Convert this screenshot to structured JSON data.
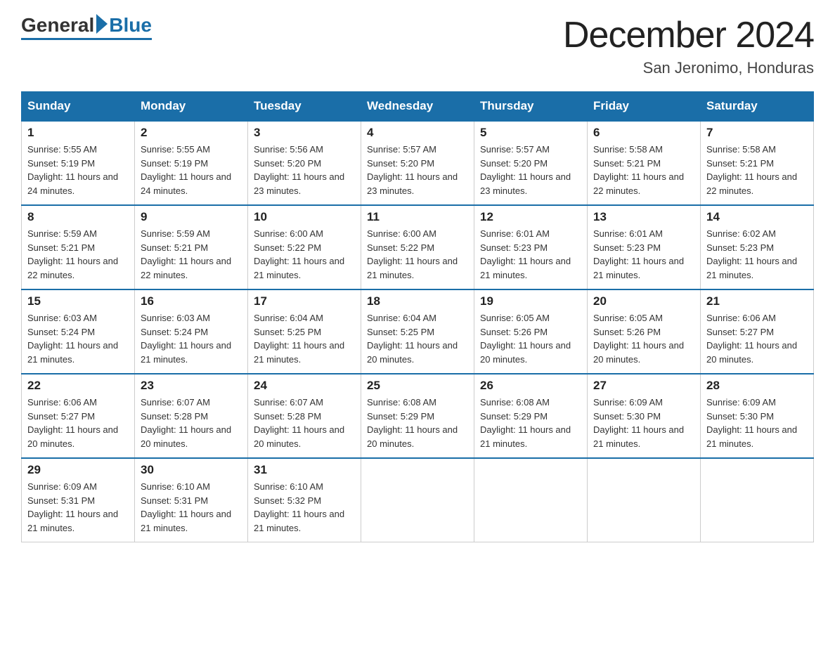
{
  "header": {
    "logo_general": "General",
    "logo_blue": "Blue",
    "month_title": "December 2024",
    "location": "San Jeronimo, Honduras"
  },
  "weekdays": [
    "Sunday",
    "Monday",
    "Tuesday",
    "Wednesday",
    "Thursday",
    "Friday",
    "Saturday"
  ],
  "weeks": [
    [
      {
        "day": "1",
        "sunrise": "5:55 AM",
        "sunset": "5:19 PM",
        "daylight": "11 hours and 24 minutes."
      },
      {
        "day": "2",
        "sunrise": "5:55 AM",
        "sunset": "5:19 PM",
        "daylight": "11 hours and 24 minutes."
      },
      {
        "day": "3",
        "sunrise": "5:56 AM",
        "sunset": "5:20 PM",
        "daylight": "11 hours and 23 minutes."
      },
      {
        "day": "4",
        "sunrise": "5:57 AM",
        "sunset": "5:20 PM",
        "daylight": "11 hours and 23 minutes."
      },
      {
        "day": "5",
        "sunrise": "5:57 AM",
        "sunset": "5:20 PM",
        "daylight": "11 hours and 23 minutes."
      },
      {
        "day": "6",
        "sunrise": "5:58 AM",
        "sunset": "5:21 PM",
        "daylight": "11 hours and 22 minutes."
      },
      {
        "day": "7",
        "sunrise": "5:58 AM",
        "sunset": "5:21 PM",
        "daylight": "11 hours and 22 minutes."
      }
    ],
    [
      {
        "day": "8",
        "sunrise": "5:59 AM",
        "sunset": "5:21 PM",
        "daylight": "11 hours and 22 minutes."
      },
      {
        "day": "9",
        "sunrise": "5:59 AM",
        "sunset": "5:21 PM",
        "daylight": "11 hours and 22 minutes."
      },
      {
        "day": "10",
        "sunrise": "6:00 AM",
        "sunset": "5:22 PM",
        "daylight": "11 hours and 21 minutes."
      },
      {
        "day": "11",
        "sunrise": "6:00 AM",
        "sunset": "5:22 PM",
        "daylight": "11 hours and 21 minutes."
      },
      {
        "day": "12",
        "sunrise": "6:01 AM",
        "sunset": "5:23 PM",
        "daylight": "11 hours and 21 minutes."
      },
      {
        "day": "13",
        "sunrise": "6:01 AM",
        "sunset": "5:23 PM",
        "daylight": "11 hours and 21 minutes."
      },
      {
        "day": "14",
        "sunrise": "6:02 AM",
        "sunset": "5:23 PM",
        "daylight": "11 hours and 21 minutes."
      }
    ],
    [
      {
        "day": "15",
        "sunrise": "6:03 AM",
        "sunset": "5:24 PM",
        "daylight": "11 hours and 21 minutes."
      },
      {
        "day": "16",
        "sunrise": "6:03 AM",
        "sunset": "5:24 PM",
        "daylight": "11 hours and 21 minutes."
      },
      {
        "day": "17",
        "sunrise": "6:04 AM",
        "sunset": "5:25 PM",
        "daylight": "11 hours and 21 minutes."
      },
      {
        "day": "18",
        "sunrise": "6:04 AM",
        "sunset": "5:25 PM",
        "daylight": "11 hours and 20 minutes."
      },
      {
        "day": "19",
        "sunrise": "6:05 AM",
        "sunset": "5:26 PM",
        "daylight": "11 hours and 20 minutes."
      },
      {
        "day": "20",
        "sunrise": "6:05 AM",
        "sunset": "5:26 PM",
        "daylight": "11 hours and 20 minutes."
      },
      {
        "day": "21",
        "sunrise": "6:06 AM",
        "sunset": "5:27 PM",
        "daylight": "11 hours and 20 minutes."
      }
    ],
    [
      {
        "day": "22",
        "sunrise": "6:06 AM",
        "sunset": "5:27 PM",
        "daylight": "11 hours and 20 minutes."
      },
      {
        "day": "23",
        "sunrise": "6:07 AM",
        "sunset": "5:28 PM",
        "daylight": "11 hours and 20 minutes."
      },
      {
        "day": "24",
        "sunrise": "6:07 AM",
        "sunset": "5:28 PM",
        "daylight": "11 hours and 20 minutes."
      },
      {
        "day": "25",
        "sunrise": "6:08 AM",
        "sunset": "5:29 PM",
        "daylight": "11 hours and 20 minutes."
      },
      {
        "day": "26",
        "sunrise": "6:08 AM",
        "sunset": "5:29 PM",
        "daylight": "11 hours and 21 minutes."
      },
      {
        "day": "27",
        "sunrise": "6:09 AM",
        "sunset": "5:30 PM",
        "daylight": "11 hours and 21 minutes."
      },
      {
        "day": "28",
        "sunrise": "6:09 AM",
        "sunset": "5:30 PM",
        "daylight": "11 hours and 21 minutes."
      }
    ],
    [
      {
        "day": "29",
        "sunrise": "6:09 AM",
        "sunset": "5:31 PM",
        "daylight": "11 hours and 21 minutes."
      },
      {
        "day": "30",
        "sunrise": "6:10 AM",
        "sunset": "5:31 PM",
        "daylight": "11 hours and 21 minutes."
      },
      {
        "day": "31",
        "sunrise": "6:10 AM",
        "sunset": "5:32 PM",
        "daylight": "11 hours and 21 minutes."
      },
      null,
      null,
      null,
      null
    ]
  ],
  "labels": {
    "sunrise": "Sunrise:",
    "sunset": "Sunset:",
    "daylight": "Daylight:"
  }
}
